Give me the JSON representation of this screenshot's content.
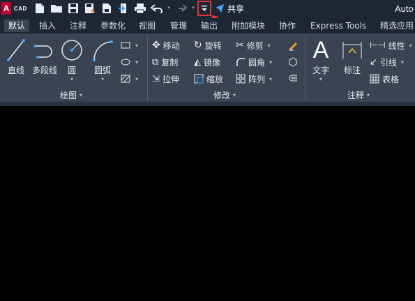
{
  "app": {
    "logo_text": "A",
    "logo_sub": "CAD",
    "title": "Auto"
  },
  "quick_access": {
    "share_label": "共享",
    "highlighted": "customize-dropdown"
  },
  "tabs": [
    {
      "label": "默认",
      "active": true
    },
    {
      "label": "插入"
    },
    {
      "label": "注释"
    },
    {
      "label": "参数化"
    },
    {
      "label": "视图"
    },
    {
      "label": "管理"
    },
    {
      "label": "输出"
    },
    {
      "label": "附加模块"
    },
    {
      "label": "协作"
    },
    {
      "label": "Express Tools"
    },
    {
      "label": "精选应用"
    }
  ],
  "draw": {
    "panel_label": "绘图",
    "line": "直线",
    "polyline": "多段线",
    "circle": "圆",
    "arc": "圆弧"
  },
  "modify": {
    "panel_label": "修改",
    "move": "移动",
    "rotate": "旋转",
    "trim": "修剪",
    "copy": "复制",
    "mirror": "镜像",
    "fillet": "圆角",
    "stretch": "拉伸",
    "scale": "缩放",
    "array": "阵列"
  },
  "annotation": {
    "panel_label": "注释",
    "text": "文字",
    "dimension": "标注",
    "linear": "线性",
    "leader": "引线",
    "table": "表格"
  },
  "colors": {
    "titlebar": "#1e2633",
    "ribbon": "#3a4352",
    "canvas": "#000000",
    "highlight": "#e23434",
    "accent": "#4aa3ff"
  }
}
